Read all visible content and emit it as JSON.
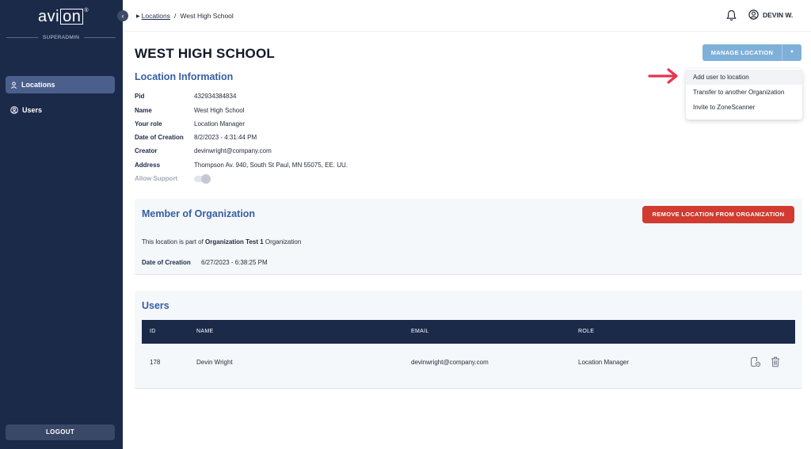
{
  "sidebar": {
    "logo_left": "avi",
    "logo_box": "on",
    "logo_reg": "®",
    "role": "SUPERADMIN",
    "collapse_icon": "chevron-left-icon",
    "items": [
      {
        "label": "Locations",
        "icon": "pin-icon",
        "active": true
      },
      {
        "label": "Users",
        "icon": "user-circle-icon",
        "active": false
      }
    ],
    "logout_label": "LOGOUT"
  },
  "topbar": {
    "breadcrumb": {
      "link": "Locations",
      "separator": "/",
      "current": "West High School"
    },
    "user_name": "DEVIN W."
  },
  "page": {
    "title": "WEST HIGH SCHOOL",
    "section_title": "Location Information",
    "info": [
      {
        "label": "Pid",
        "value": "432934384834"
      },
      {
        "label": "Name",
        "value": "West High School"
      },
      {
        "label": "Your role",
        "value": "Location Manager"
      },
      {
        "label": "Date of Creation",
        "value": "8/2/2023 - 4:31:44 PM"
      },
      {
        "label": "Creator",
        "value": "devinwright@company.com"
      },
      {
        "label": "Address",
        "value": "Thompson Av. 940, South St Paul, MN 55075, EE. UU."
      }
    ],
    "allow_support_label": "Allow Support",
    "allow_support_on": false
  },
  "manage": {
    "label": "MANAGE LOCATION",
    "arrow": "▼",
    "menu": [
      "Add user to location",
      "Transfer to another Organization",
      "Invite to ZoneScanner"
    ]
  },
  "member": {
    "title": "Member of Organization",
    "remove_label": "REMOVE LOCATION FROM ORGANIZATION",
    "text_prefix": "This location is part of ",
    "org_name": "Organization Test 1",
    "text_suffix": " Organization",
    "date_label": "Date of Creation",
    "date_value": "6/27/2023 - 6:38:25 PM"
  },
  "users": {
    "title": "Users",
    "columns": [
      "ID",
      "NAME",
      "EMAIL",
      "ROLE"
    ],
    "rows": [
      {
        "id": "178",
        "name": "Devin Wright",
        "email": "devinwright@company.com",
        "role": "Location Manager"
      }
    ]
  },
  "colors": {
    "sidebar": "#1c2a4a",
    "accent": "#355ea3",
    "manage_button": "#7fb0d9",
    "danger": "#d13b30",
    "annotation_arrow": "#e8334f"
  }
}
